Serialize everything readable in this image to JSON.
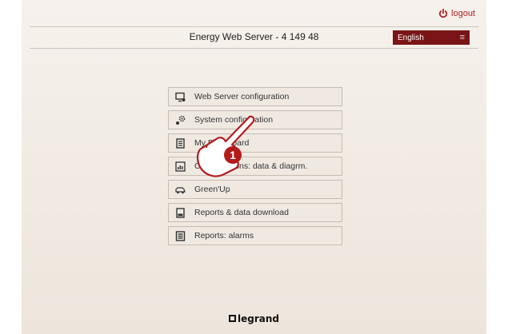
{
  "header": {
    "logout_label": "logout",
    "title": "Energy Web Server - 4 149 48",
    "language": "English",
    "accent_color": "#7a1416"
  },
  "menu": {
    "items": [
      {
        "label": "Web Server configuration",
        "icon": "monitor-gear-icon"
      },
      {
        "label": "System configuration",
        "icon": "gears-icon"
      },
      {
        "label": "My Dashboard",
        "icon": "list-icon"
      },
      {
        "label": "Consumptions: data & diagrm.",
        "icon": "chart-icon"
      },
      {
        "label": "Green'Up",
        "icon": "car-plug-icon"
      },
      {
        "label": "Reports & data download",
        "icon": "report-download-icon"
      },
      {
        "label": "Reports: alarms",
        "icon": "report-alarm-icon"
      }
    ]
  },
  "annotation": {
    "step_number": "1"
  },
  "footer": {
    "brand": "legrand"
  }
}
